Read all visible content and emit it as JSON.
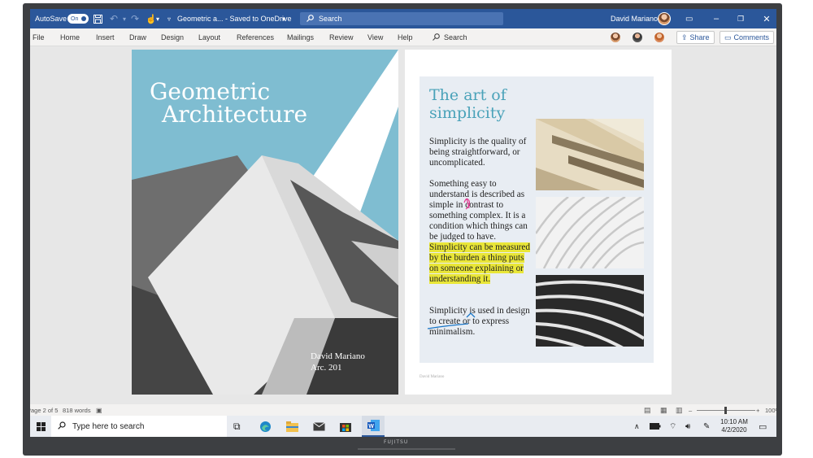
{
  "titlebar": {
    "autosave_label": "AutoSave",
    "autosave_state": "On",
    "doc_title": "Geometric a... - Saved to OneDrive",
    "search_placeholder": "Search",
    "user_name": "David Mariano"
  },
  "menu": {
    "items": [
      "File",
      "Home",
      "Insert",
      "Draw",
      "Design",
      "Layout",
      "References",
      "Mailings",
      "Review",
      "View",
      "Help"
    ],
    "search_label": "Search",
    "share_label": "Share",
    "comments_label": "Comments"
  },
  "cover": {
    "title_line1": "Geometric",
    "title_line2": "Architecture",
    "author": "David Mariano",
    "course": "Arc. 201"
  },
  "page2": {
    "heading": "The art of simplicity",
    "para1": "Simplicity is the quality of being straightforward, or uncomplicated.",
    "para2_plain": "Something easy to understand is described as simple in contrast to something complex. It is a condition which things can be judged to have.",
    "para2_highlight": "Simplicity can be measured by the burden a thing puts on someone explaining or understanding it.",
    "para3": "Simplicity is used in design to create or to express minimalism.",
    "footer": "David Mariano"
  },
  "status": {
    "page": "Page 2 of 5",
    "words": "818 words",
    "zoom": "100%"
  },
  "taskbar": {
    "search_placeholder": "Type here to search",
    "time": "10:10 AM",
    "date": "4/2/2020"
  },
  "bezel": {
    "brand": "FUJITSU"
  },
  "colors": {
    "word_blue": "#2b579a",
    "highlight": "#e9e638",
    "heading_teal": "#4aa2b9",
    "ink_magenta": "#e0338e",
    "ink_blue": "#1976c7"
  }
}
